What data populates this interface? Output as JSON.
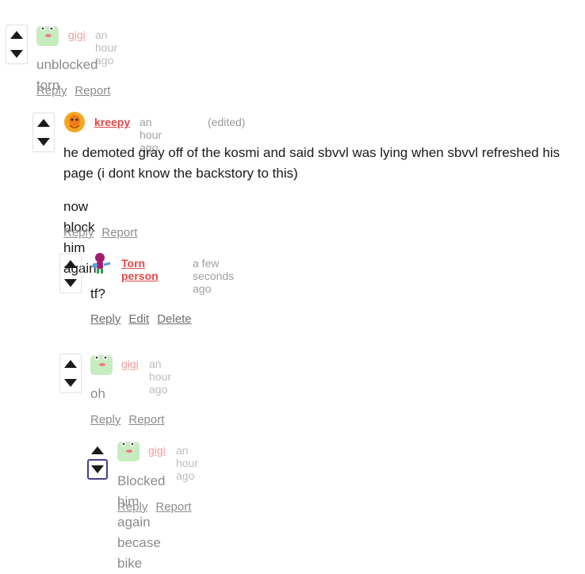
{
  "comments": [
    {
      "author": "gigi",
      "time": "an hour ago",
      "body": [
        "unblocked torn"
      ],
      "actions": [
        "Reply",
        "Report"
      ]
    },
    {
      "author": "kreepy",
      "time": "an hour ago",
      "edited": "(edited)",
      "body": [
        "he demoted gray off of the kosmi and said sbvvl was lying when sbvvl  refreshed his page (i dont know the backstory to this)",
        "now block him again"
      ],
      "actions": [
        "Reply",
        "Report"
      ]
    },
    {
      "author": "Torn person",
      "time": "a few seconds ago",
      "body": [
        "tf?"
      ],
      "actions": [
        "Reply",
        "Edit",
        "Delete"
      ]
    },
    {
      "author": "gigi",
      "time": "an hour ago",
      "body": [
        "oh"
      ],
      "actions": [
        "Reply",
        "Report"
      ]
    },
    {
      "author": "gigi",
      "time": "an hour ago",
      "body": [
        "Blocked him again becase bike"
      ],
      "actions": [
        "Reply",
        "Report"
      ]
    }
  ],
  "icons": {
    "upvote": "triangle-up-icon",
    "downvote": "triangle-down-icon"
  },
  "colors": {
    "author_active": "#e24848",
    "author_faded": "#f29a9a",
    "vote_selected_border": "#4a3d8f"
  }
}
